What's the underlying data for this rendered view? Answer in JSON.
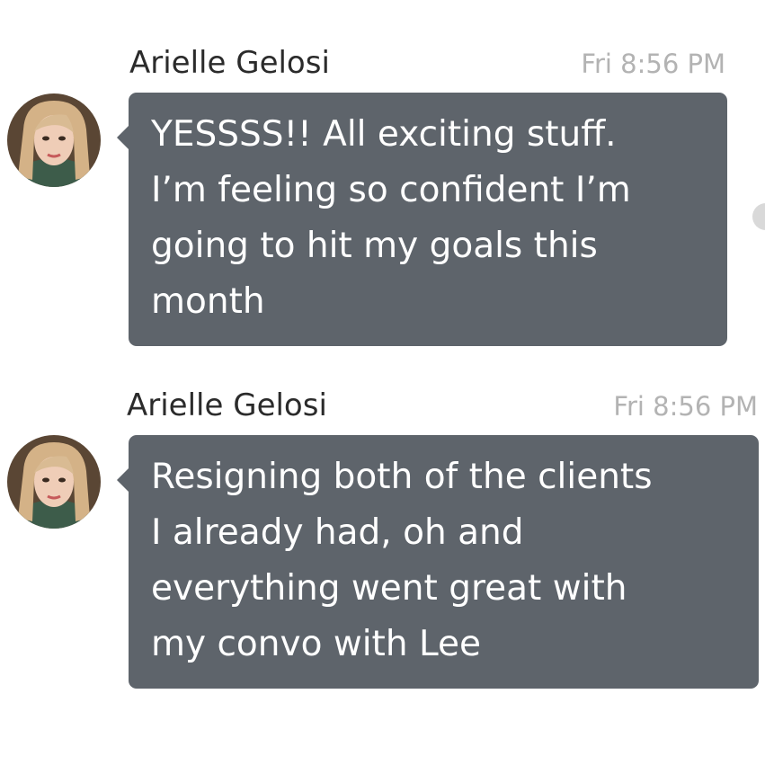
{
  "messages": [
    {
      "sender": "Arielle Gelosi",
      "timestamp": "Fri 8:56 PM",
      "text": "YESSSS!! All exciting stuff.\nI’m feeling so confident I’m\ngoing to hit my goals this\nmonth"
    },
    {
      "sender": "Arielle Gelosi",
      "timestamp": "Fri 8:56 PM",
      "text": "Resigning both of the clients\nI already had, oh and\neverything went great with\nmy convo with Lee"
    }
  ],
  "colors": {
    "bubble": "#5e646b",
    "bubble_text": "#ffffff",
    "sender_text": "#2b2b2b",
    "timestamp_text": "#b3b3b3",
    "background": "#ffffff"
  },
  "icons": {
    "avatar": "profile-photo-avatar"
  }
}
